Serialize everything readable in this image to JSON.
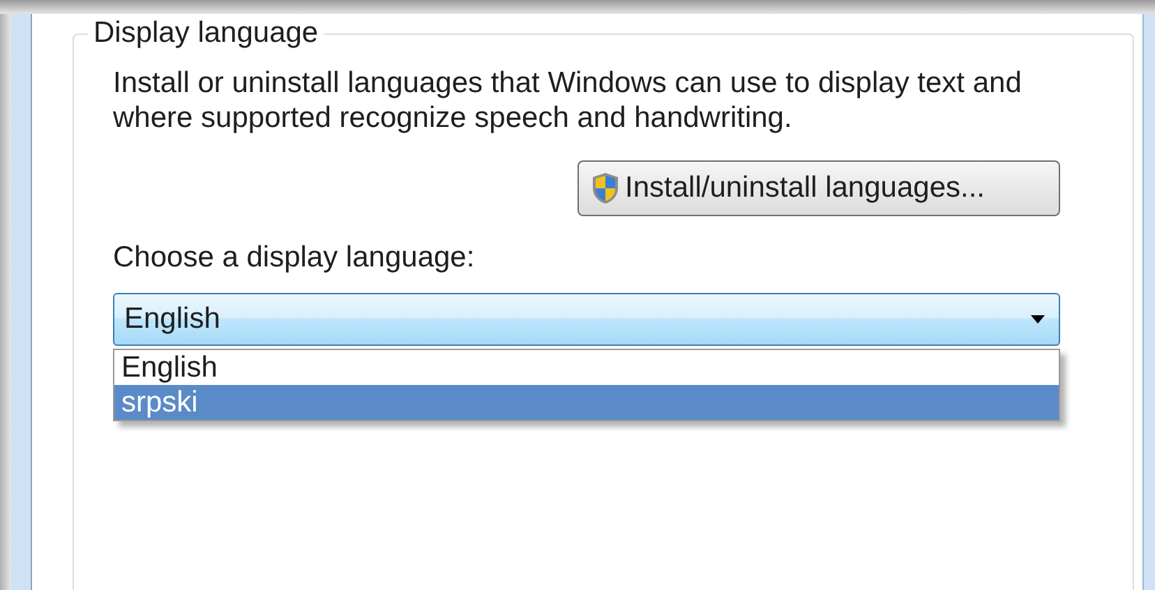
{
  "group": {
    "title": "Display language"
  },
  "description": "Install or uninstall languages that Windows can use to display text and where supported recognize speech and handwriting.",
  "install_button": {
    "label": "Install/uninstall languages..."
  },
  "language_select": {
    "label": "Choose a display language:",
    "value": "English",
    "expanded": true,
    "options": [
      {
        "label": "English",
        "highlighted": false
      },
      {
        "label": "srpski",
        "highlighted": true
      }
    ]
  }
}
